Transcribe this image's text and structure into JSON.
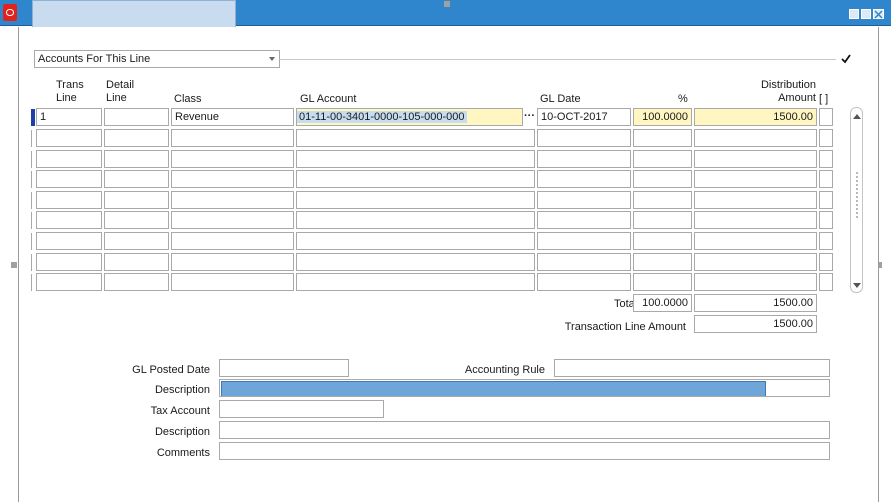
{
  "window": {
    "title": "",
    "logo_icon": "oracle-logo-icon"
  },
  "accounts_dropdown": {
    "value": "Accounts For This Line"
  },
  "columns": {
    "trans_line": [
      "Trans",
      "Line"
    ],
    "detail_line": [
      "Detail",
      "Line"
    ],
    "class": "Class",
    "gl_account": "GL Account",
    "gl_date": "GL Date",
    "percent": "%",
    "distribution_amount": [
      "Distribution",
      "Amount"
    ],
    "flex": "[ ]"
  },
  "rows": [
    {
      "trans_line": "1",
      "detail_line": "",
      "class": "Revenue",
      "gl_account": "01-11-00-3401-0000-105-000-000",
      "gl_date": "10-OCT-2017",
      "percent": "100.0000",
      "amount": "1500.00"
    }
  ],
  "empty_rows": 8,
  "totals": {
    "label": "Tota",
    "percent": "100.0000",
    "amount": "1500.00"
  },
  "transaction_line": {
    "label": "Transaction Line Amount",
    "amount": "1500.00"
  },
  "detail": {
    "gl_posted_date_label": "GL Posted Date",
    "gl_posted_date": "",
    "accounting_rule_label": "Accounting Rule",
    "accounting_rule": "",
    "description_label": "Description",
    "description_progress": 0.9,
    "tax_account_label": "Tax Account",
    "tax_account": "",
    "description2_label": "Description",
    "description2": "",
    "comments_label": "Comments",
    "comments": ""
  },
  "icons": [
    "oracle-logo-icon",
    "minimize-icon",
    "maximize-icon",
    "close-icon",
    "dropdown-arrow-icon",
    "list-of-values-icon",
    "scroll-up-icon",
    "scroll-down-icon",
    "checkbox-icon"
  ]
}
